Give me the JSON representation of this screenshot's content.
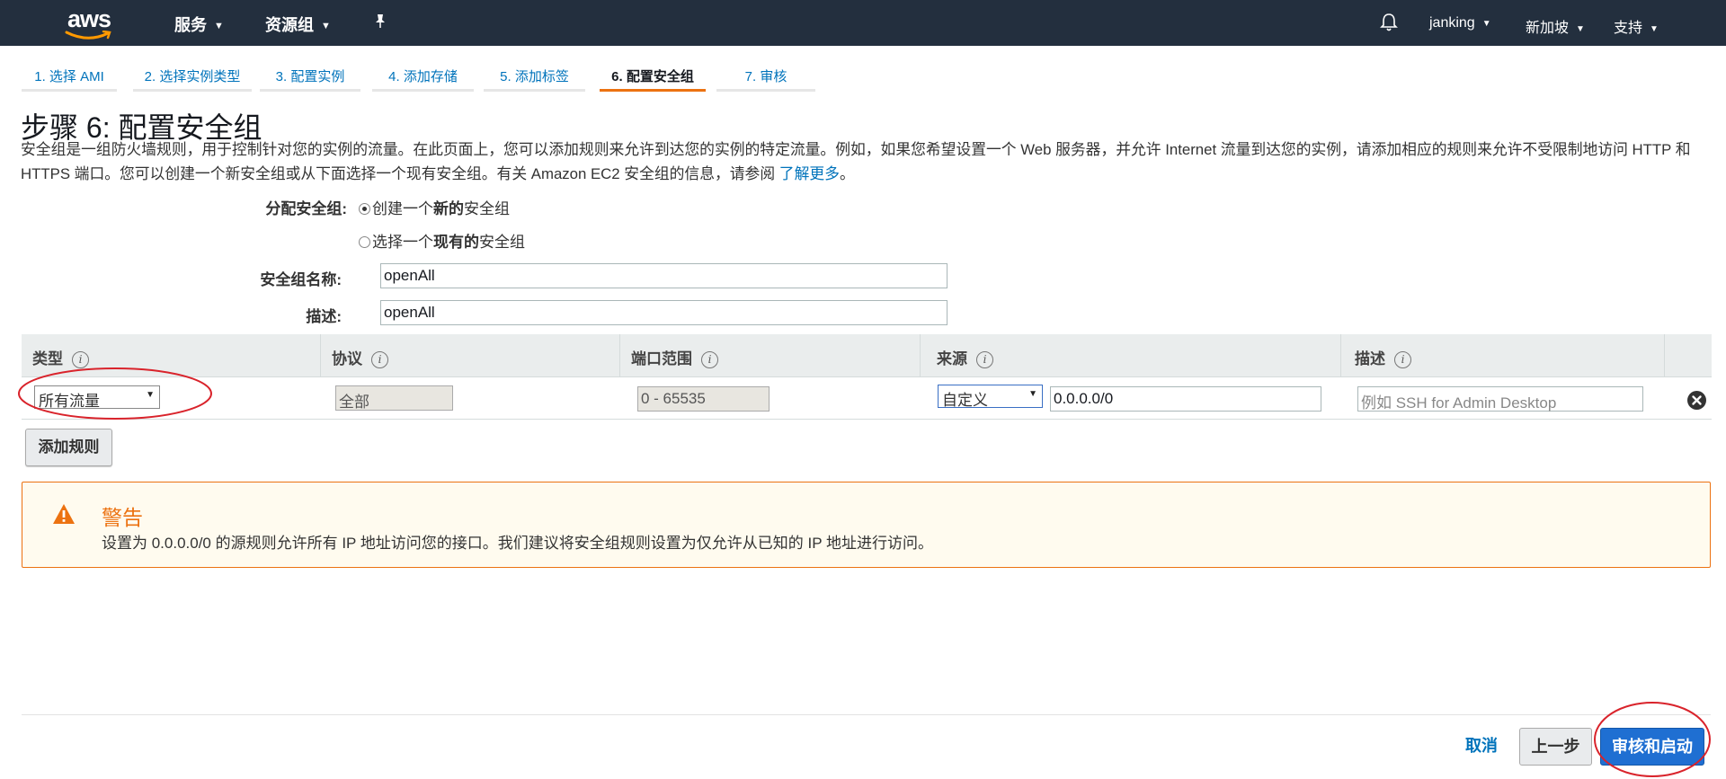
{
  "topnav": {
    "logo_text": "aws",
    "services": "服务",
    "resource_groups": "资源组",
    "user": "janking",
    "region": "新加坡",
    "support": "支持"
  },
  "steps": [
    {
      "label": "1. 选择 AMI"
    },
    {
      "label": "2. 选择实例类型"
    },
    {
      "label": "3. 配置实例"
    },
    {
      "label": "4. 添加存储"
    },
    {
      "label": "5. 添加标签"
    },
    {
      "label": "6. 配置安全组",
      "active": true
    },
    {
      "label": "7. 审核"
    }
  ],
  "page": {
    "title": "步骤 6: 配置安全组",
    "description": "安全组是一组防火墙规则，用于控制针对您的实例的流量。在此页面上，您可以添加规则来允许到达您的实例的特定流量。例如，如果您希望设置一个 Web 服务器，并允许 Internet 流量到达您的实例，请添加相应的规则来允许不受限制地访问 HTTP 和 HTTPS 端口。您可以创建一个新安全组或从下面选择一个现有安全组。有关 Amazon EC2 安全组的信息，请参阅",
    "learn_more": "了解更多",
    "period": "。"
  },
  "form": {
    "assign_label": "分配安全组:",
    "create_new": {
      "pre": "创建一个",
      "bold": "新的",
      "post": "安全组"
    },
    "select_existing": {
      "pre": "选择一个",
      "bold": "现有的",
      "post": "安全组"
    },
    "name_label": "安全组名称:",
    "name_value": "openAll",
    "desc_label": "描述:",
    "desc_value": "openAll"
  },
  "table": {
    "headers": {
      "type": "类型",
      "protocol": "协议",
      "port_range": "端口范围",
      "source": "来源",
      "description": "描述"
    },
    "info_glyph": "i",
    "row": {
      "type": "所有流量",
      "protocol": "全部",
      "port_range": "0 - 65535",
      "source_type": "自定义",
      "source_value": "0.0.0.0/0",
      "description_placeholder": "例如 SSH for Admin Desktop"
    }
  },
  "add_rule": "添加规则",
  "warning": {
    "title": "警告",
    "text": "设置为 0.0.0.0/0 的源规则允许所有 IP 地址访问您的接口。我们建议将安全组规则设置为仅允许从已知的 IP 地址进行访问。"
  },
  "footer": {
    "cancel": "取消",
    "previous": "上一步",
    "review_launch": "审核和启动"
  },
  "colors": {
    "nav_bg": "#232f3e",
    "link": "#0073bb",
    "warning": "#ec7211",
    "primary_button": "#1f6fd2",
    "annotation_circle": "#d9232b"
  },
  "icons": [
    "pin-icon",
    "bell-icon",
    "info-icon",
    "warning-icon",
    "remove-icon",
    "caret-down-icon"
  ]
}
